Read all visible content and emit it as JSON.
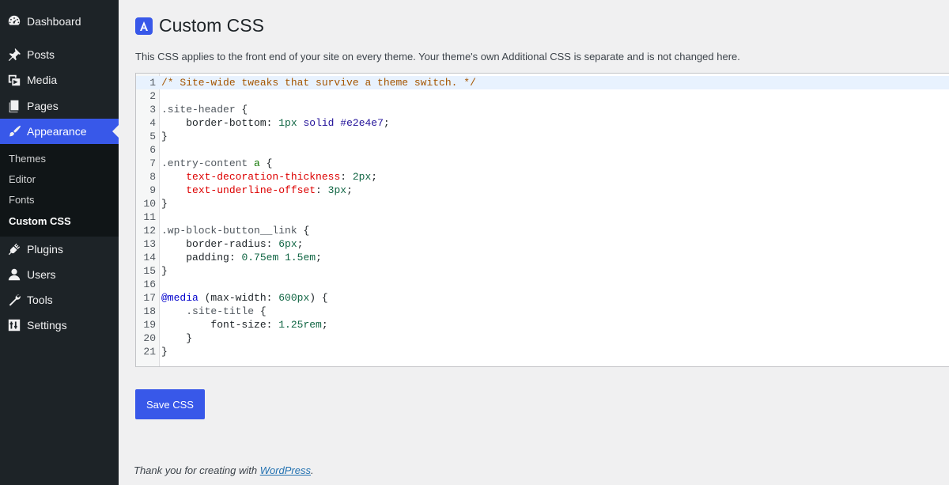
{
  "sidebar": {
    "items": [
      {
        "label": "Dashboard",
        "icon": "dashboard-icon"
      },
      {
        "label": "Posts",
        "icon": "pushpin-icon"
      },
      {
        "label": "Media",
        "icon": "media-icon"
      },
      {
        "label": "Pages",
        "icon": "pages-icon"
      },
      {
        "label": "Appearance",
        "icon": "paintbrush-icon"
      },
      {
        "label": "Plugins",
        "icon": "plugin-icon"
      },
      {
        "label": "Users",
        "icon": "user-icon"
      },
      {
        "label": "Tools",
        "icon": "wrench-icon"
      },
      {
        "label": "Settings",
        "icon": "settings-icon"
      }
    ],
    "submenu": [
      "Themes",
      "Editor",
      "Fonts",
      "Custom CSS"
    ],
    "accent_color": "#3858e9"
  },
  "page": {
    "title": "Custom CSS",
    "description": "This CSS applies to the front end of your site on every theme. Your theme's own Additional CSS is separate and is not changed here.",
    "save_label": "Save CSS",
    "footer_text": "Thank you for creating with ",
    "footer_link": "WordPress",
    "footer_end": "."
  },
  "editor": {
    "line_numbers": [
      "1",
      "2",
      "3",
      "4",
      "5",
      "6",
      "7",
      "8",
      "9",
      "10",
      "11",
      "12",
      "13",
      "14",
      "15",
      "16",
      "17",
      "18",
      "19",
      "20",
      "21"
    ],
    "lines": [
      "/* Site-wide tweaks that survive a theme switch. */",
      "",
      ".site-header {",
      "    border-bottom: 1px solid #e2e4e7;",
      "}",
      "",
      ".entry-content a {",
      "    text-decoration-thickness: 2px;",
      "    text-underline-offset: 3px;",
      "}",
      "",
      ".wp-block-button__link {",
      "    border-radius: 6px;",
      "    padding: 0.75em 1.5em;",
      "}",
      "",
      "@media (max-width: 600px) {",
      "    .site-title {",
      "        font-size: 1.25rem;",
      "    }",
      "}"
    ]
  }
}
